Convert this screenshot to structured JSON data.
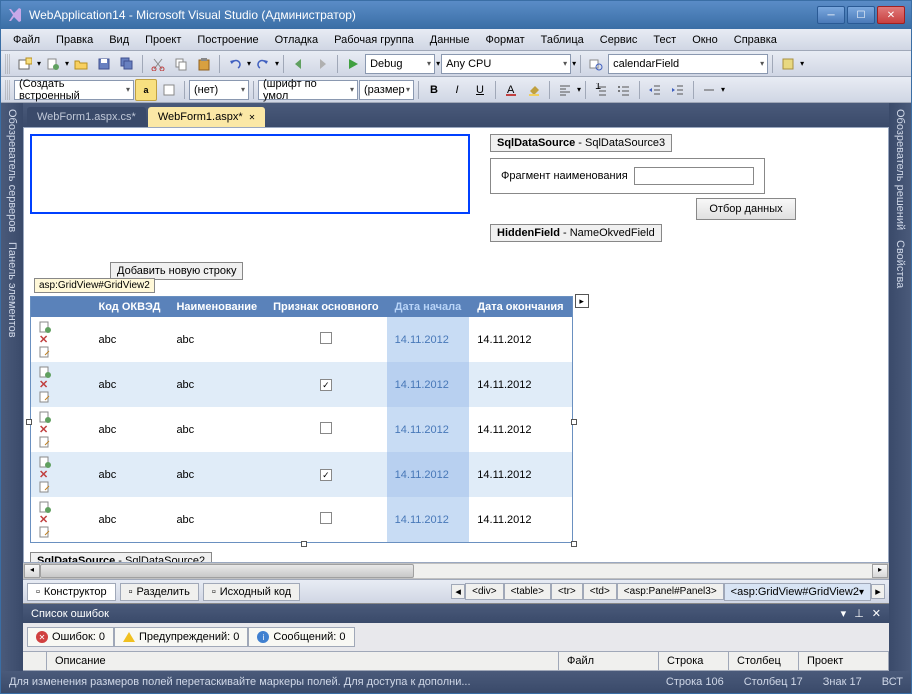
{
  "window": {
    "title": "WebApplication14 - Microsoft Visual Studio (Администратор)"
  },
  "menu": [
    "Файл",
    "Правка",
    "Вид",
    "Проект",
    "Построение",
    "Отладка",
    "Рабочая группа",
    "Данные",
    "Формат",
    "Таблица",
    "Сервис",
    "Тест",
    "Окно",
    "Справка"
  ],
  "toolbar1": {
    "config": "Debug",
    "platform": "Any CPU",
    "find": "calendarField"
  },
  "toolbar2": {
    "target": "(Создать встроенный",
    "style": "(нет)",
    "font": "(шрифт по умол",
    "size": "(размер"
  },
  "sidebars": {
    "left": [
      "Обозреватель серверов",
      "Панель элементов"
    ],
    "right": [
      "Обозреватель решений",
      "Свойства"
    ]
  },
  "tabs": [
    {
      "label": "WebForm1.aspx.cs*",
      "active": false
    },
    {
      "label": "WebForm1.aspx*",
      "active": true
    }
  ],
  "designer": {
    "sqlds3": "SqlDataSource - SqlDataSource3",
    "fragLabel": "Фрагмент наименования",
    "filterBtn": "Отбор данных",
    "hidden": "HiddenField - NameOkvedField",
    "addRow": "Добавить новую строку",
    "gvLabel": "asp:GridView#GridView2",
    "sqlds2": "SqlDataSource - SqlDataSource2"
  },
  "grid": {
    "headers": [
      "",
      "Код ОКВЭД",
      "Наименование",
      "Признак основного",
      "Дата начала",
      "Дата окончания"
    ],
    "rows": [
      {
        "code": "abc",
        "name": "abc",
        "main": false,
        "start": "14.11.2012",
        "end": "14.11.2012"
      },
      {
        "code": "abc",
        "name": "abc",
        "main": true,
        "start": "14.11.2012",
        "end": "14.11.2012"
      },
      {
        "code": "abc",
        "name": "abc",
        "main": false,
        "start": "14.11.2012",
        "end": "14.11.2012"
      },
      {
        "code": "abc",
        "name": "abc",
        "main": true,
        "start": "14.11.2012",
        "end": "14.11.2012"
      },
      {
        "code": "abc",
        "name": "abc",
        "main": false,
        "start": "14.11.2012",
        "end": "14.11.2012"
      }
    ]
  },
  "views": {
    "design": "Конструктор",
    "split": "Разделить",
    "source": "Исходный код"
  },
  "breadcrumb": [
    "<div>",
    "<table>",
    "<tr>",
    "<td>",
    "<asp:Panel#Panel3>",
    "<asp:GridView#GridView2"
  ],
  "errors": {
    "title": "Список ошибок",
    "err": "Ошибок: 0",
    "warn": "Предупреждений: 0",
    "msg": "Сообщений: 0",
    "cols": [
      "",
      "Описание",
      "Файл",
      "Строка",
      "Столбец",
      "Проект"
    ]
  },
  "status": {
    "hint": "Для изменения размеров полей перетаскивайте маркеры полей. Для доступа к дополни...",
    "line": "Строка 106",
    "col": "Столбец 17",
    "ch": "Знак 17",
    "ins": "ВСТ"
  }
}
